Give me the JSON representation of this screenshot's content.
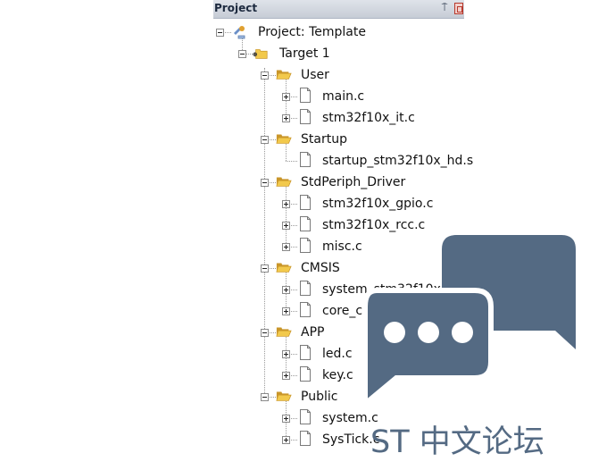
{
  "window": {
    "title": "Project",
    "pin_glyph": "⍑"
  },
  "tree": [
    {
      "label": "Project: Template",
      "icon": "project-icon",
      "level": 0,
      "expander": "minus"
    },
    {
      "label": "Target 1",
      "icon": "target-folder-icon",
      "level": 1,
      "expander": "minus"
    },
    {
      "label": "User",
      "icon": "folder-open-icon",
      "level": 2,
      "expander": "minus"
    },
    {
      "label": "main.c",
      "icon": "file-icon",
      "level": 3,
      "expander": "plus"
    },
    {
      "label": "stm32f10x_it.c",
      "icon": "file-icon",
      "level": 3,
      "expander": "plus"
    },
    {
      "label": "Startup",
      "icon": "folder-open-icon",
      "level": 2,
      "expander": "minus"
    },
    {
      "label": "startup_stm32f10x_hd.s",
      "icon": "file-icon",
      "level": 3,
      "expander": "none"
    },
    {
      "label": "StdPeriph_Driver",
      "icon": "folder-open-icon",
      "level": 2,
      "expander": "minus"
    },
    {
      "label": "stm32f10x_gpio.c",
      "icon": "file-icon",
      "level": 3,
      "expander": "plus"
    },
    {
      "label": "stm32f10x_rcc.c",
      "icon": "file-icon",
      "level": 3,
      "expander": "plus"
    },
    {
      "label": "misc.c",
      "icon": "file-icon",
      "level": 3,
      "expander": "plus"
    },
    {
      "label": "CMSIS",
      "icon": "folder-open-icon",
      "level": 2,
      "expander": "minus"
    },
    {
      "label": "system_stm32f10x.c",
      "icon": "file-icon",
      "level": 3,
      "expander": "plus"
    },
    {
      "label": "core_cm3.c",
      "icon": "file-icon",
      "level": 3,
      "expander": "plus"
    },
    {
      "label": "APP",
      "icon": "folder-open-icon",
      "level": 2,
      "expander": "minus"
    },
    {
      "label": "led.c",
      "icon": "file-icon",
      "level": 3,
      "expander": "plus"
    },
    {
      "label": "key.c",
      "icon": "file-icon",
      "level": 3,
      "expander": "plus"
    },
    {
      "label": "Public",
      "icon": "folder-open-icon",
      "level": 2,
      "expander": "minus"
    },
    {
      "label": "system.c",
      "icon": "file-icon",
      "level": 3,
      "expander": "plus"
    },
    {
      "label": "SysTick.c",
      "icon": "file-icon",
      "level": 3,
      "expander": "plus"
    }
  ],
  "watermark": {
    "text": "ST 中文论坛",
    "color": "#546a83"
  },
  "colors": {
    "folder": "#f2c94c",
    "folder_dark": "#c9962a",
    "file_border": "#7a7a7a",
    "tree_line": "#9a9a9a"
  }
}
